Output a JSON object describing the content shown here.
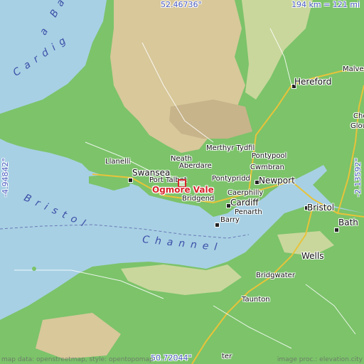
{
  "map": {
    "colors": {
      "sea": "#a7d0e4",
      "lowland": "#7cc36a",
      "midland": "#c9d79c",
      "upland": "#d8c89a",
      "highland": "#c7b48a",
      "road_major": "#e8c33a",
      "road_minor": "#ffffff",
      "water_label": "#3c4fa8",
      "focus": "#d8242c"
    },
    "coords": {
      "top": "52.46736°",
      "bottom": "50.72044°",
      "left": "-4.94842°",
      "right": "-2.13592°"
    },
    "scale": "194 km = 121 mi",
    "focus_place": "Ogmore Vale",
    "sea_labels": {
      "cardigan": "Cardig",
      "cardigan_bay": "a Bay",
      "bristol": "Bristol",
      "channel": "Channel"
    },
    "places": {
      "hereford": "Hereford",
      "merthyr": "Merthyr Tydfil",
      "pontypool": "Pontypool",
      "cwmbran": "Cwmbran",
      "newport": "Newport",
      "neath": "Neath",
      "aberdare": "Aberdare",
      "swansea": "Swansea",
      "llanelli": "Llanelli",
      "port_talbot": "Port Talbot",
      "pontypridd": "Pontypridd",
      "caerphilly": "Caerphilly",
      "bridgend": "Bridgend",
      "cardiff": "Cardiff",
      "penarth": "Penarth",
      "barry": "Barry",
      "bristol": "Bristol",
      "bath": "Bath",
      "wells": "Wells",
      "bridgwater": "Bridgwater",
      "taunton": "Taunton",
      "malvern": "Malve",
      "glouc": "Glou",
      "chelt": "Che",
      "exeter": "ter"
    },
    "credits": {
      "left": "map data: openstreetmap, style: opentopomap",
      "right": "image proc.: elevation.city"
    }
  }
}
